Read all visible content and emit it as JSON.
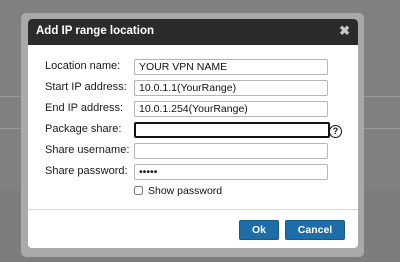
{
  "dialog": {
    "title": "Add IP range location",
    "close_glyph": "✖"
  },
  "form": {
    "location_name": {
      "label": "Location name:",
      "value": "YOUR VPN NAME"
    },
    "start_ip": {
      "label": "Start IP address:",
      "value": "10.0.1.1(YourRange)"
    },
    "end_ip": {
      "label": "End IP address:",
      "value": "10.0.1.254(YourRange)"
    },
    "package_share": {
      "label": "Package share:",
      "value": ""
    },
    "share_username": {
      "label": "Share username:",
      "value": ""
    },
    "share_password": {
      "label": "Share password:",
      "value": "•••••"
    },
    "show_password": {
      "label": "Show password",
      "checked": false
    }
  },
  "help_icon": {
    "glyph": "?"
  },
  "buttons": {
    "ok": "Ok",
    "cancel": "Cancel"
  },
  "colors": {
    "titlebar": "#2b2b2b",
    "button": "#1d6da8",
    "overlay": "#808080"
  }
}
